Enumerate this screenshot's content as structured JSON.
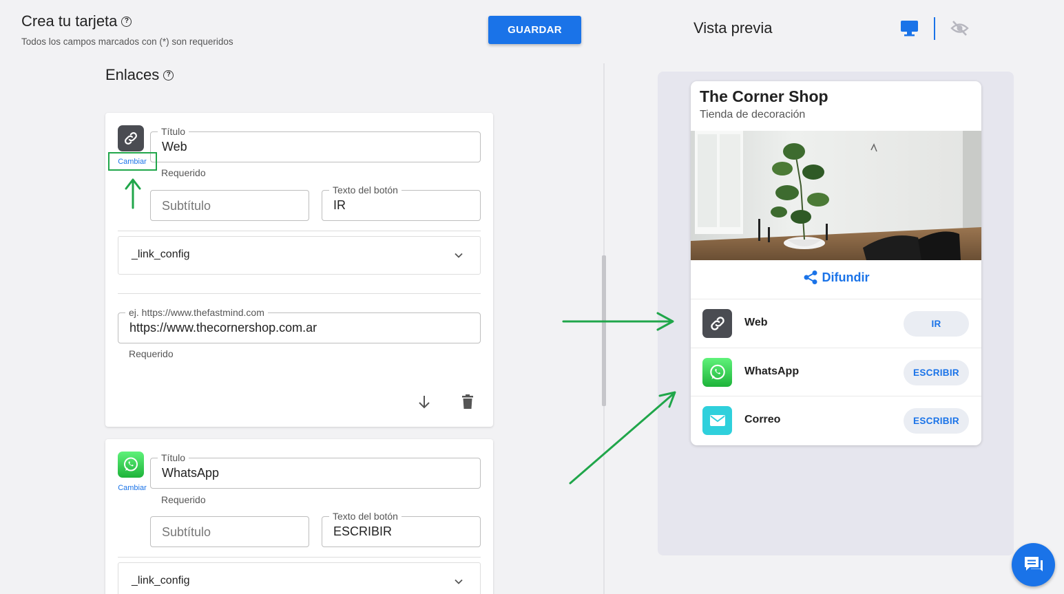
{
  "header": {
    "title": "Crea tu tarjeta",
    "subtitle": "Todos los campos marcados con (*) son requeridos",
    "save_label": "GUARDAR",
    "help_glyph": "?"
  },
  "section": {
    "title": "Enlaces"
  },
  "links": [
    {
      "icon": "link-icon",
      "change_label": "Cambiar",
      "title_label": "Título",
      "title_value": "Web",
      "required_hint": "Requerido",
      "subtitle_placeholder": "Subtítulo",
      "button_text_label": "Texto del botón",
      "button_text_value": "IR",
      "config_label": "_link_config",
      "url_label": "ej. https://www.thefastmind.com",
      "url_value": "https://www.thecornershop.com.ar",
      "url_required_hint": "Requerido"
    },
    {
      "icon": "whatsapp-icon",
      "change_label": "Cambiar",
      "title_label": "Título",
      "title_value": "WhatsApp",
      "required_hint": "Requerido",
      "subtitle_placeholder": "Subtítulo",
      "button_text_label": "Texto del botón",
      "button_text_value": "ESCRIBIR",
      "config_label": "_link_config"
    }
  ],
  "preview": {
    "title": "Vista previa",
    "shop_name": "The Corner Shop",
    "shop_subtitle": "Tienda de decoración",
    "share_label": "Difundir",
    "items": [
      {
        "icon": "link-icon",
        "label": "Web",
        "button": "IR"
      },
      {
        "icon": "whatsapp-icon",
        "label": "WhatsApp",
        "button": "ESCRIBIR"
      },
      {
        "icon": "mail-icon",
        "label": "Correo",
        "button": "ESCRIBIR"
      }
    ]
  },
  "colors": {
    "accent": "#1a73e8",
    "annotation": "#20a64a",
    "whatsapp": "#25d366",
    "mail": "#2fd0dc",
    "link_icon_bg": "#4a4c52"
  }
}
